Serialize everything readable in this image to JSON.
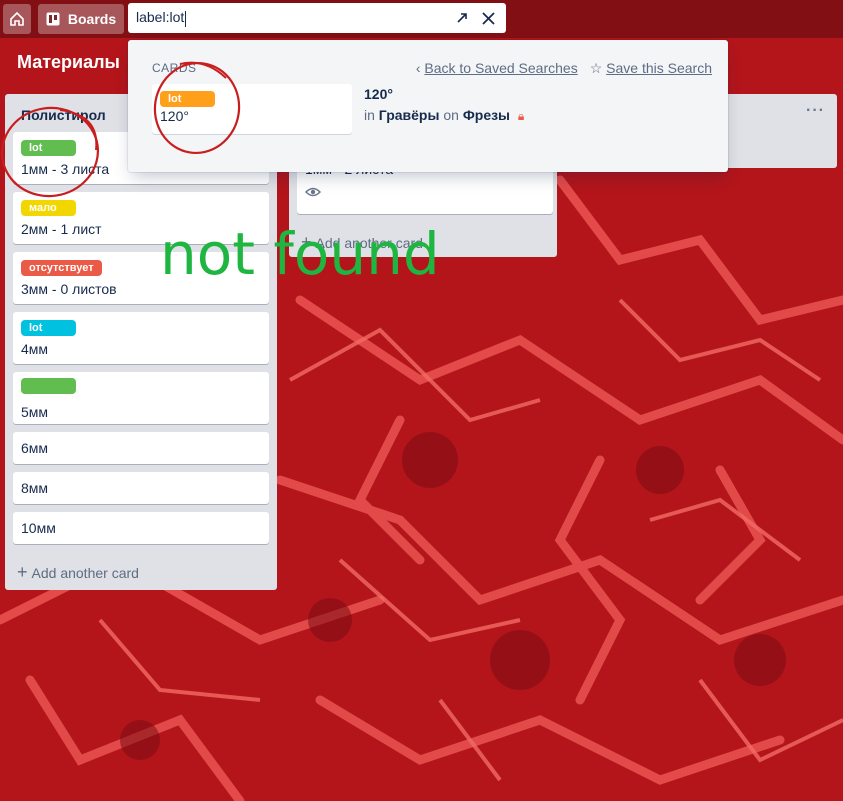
{
  "header": {
    "boards_label": "Boards",
    "search_value": "label:lot"
  },
  "board": {
    "title": "Материалы"
  },
  "lists": [
    {
      "title": "Полистирол",
      "cards": [
        {
          "label": "lot",
          "label_color": "#61bd4f",
          "title": "1мм - 3 листа"
        },
        {
          "label": "мало",
          "label_color": "#f2d600",
          "title": "2мм - 1 лист"
        },
        {
          "label": "отсутствует",
          "label_color": "#eb5a46",
          "title": "3мм - 0 листов"
        },
        {
          "label": "lot",
          "label_color": "#00c2e0",
          "title": "4мм"
        },
        {
          "label": "",
          "label_color": "#61bd4f",
          "title": "5мм"
        },
        {
          "title": "6мм"
        },
        {
          "title": "8мм"
        },
        {
          "title": "10мм"
        }
      ],
      "add_card": "Add another card"
    },
    {
      "title": "",
      "cards": [
        {
          "title": "1мм - 2 листа"
        }
      ],
      "add_card": "Add another card"
    }
  ],
  "search_popover": {
    "section": "CARDS",
    "back_link": "Back to Saved Searches",
    "save_link": "Save this Search",
    "result": {
      "label": "lot",
      "label_color": "#ff9f1a",
      "card_title": "120°",
      "title": "120°",
      "in_text": "in",
      "list_name": "Гравёры",
      "on_text": "on",
      "board_name": "Фрезы"
    }
  },
  "annotation": {
    "text": "not found",
    "color": "#1fb541",
    "circle_color": "#c81e1e"
  }
}
